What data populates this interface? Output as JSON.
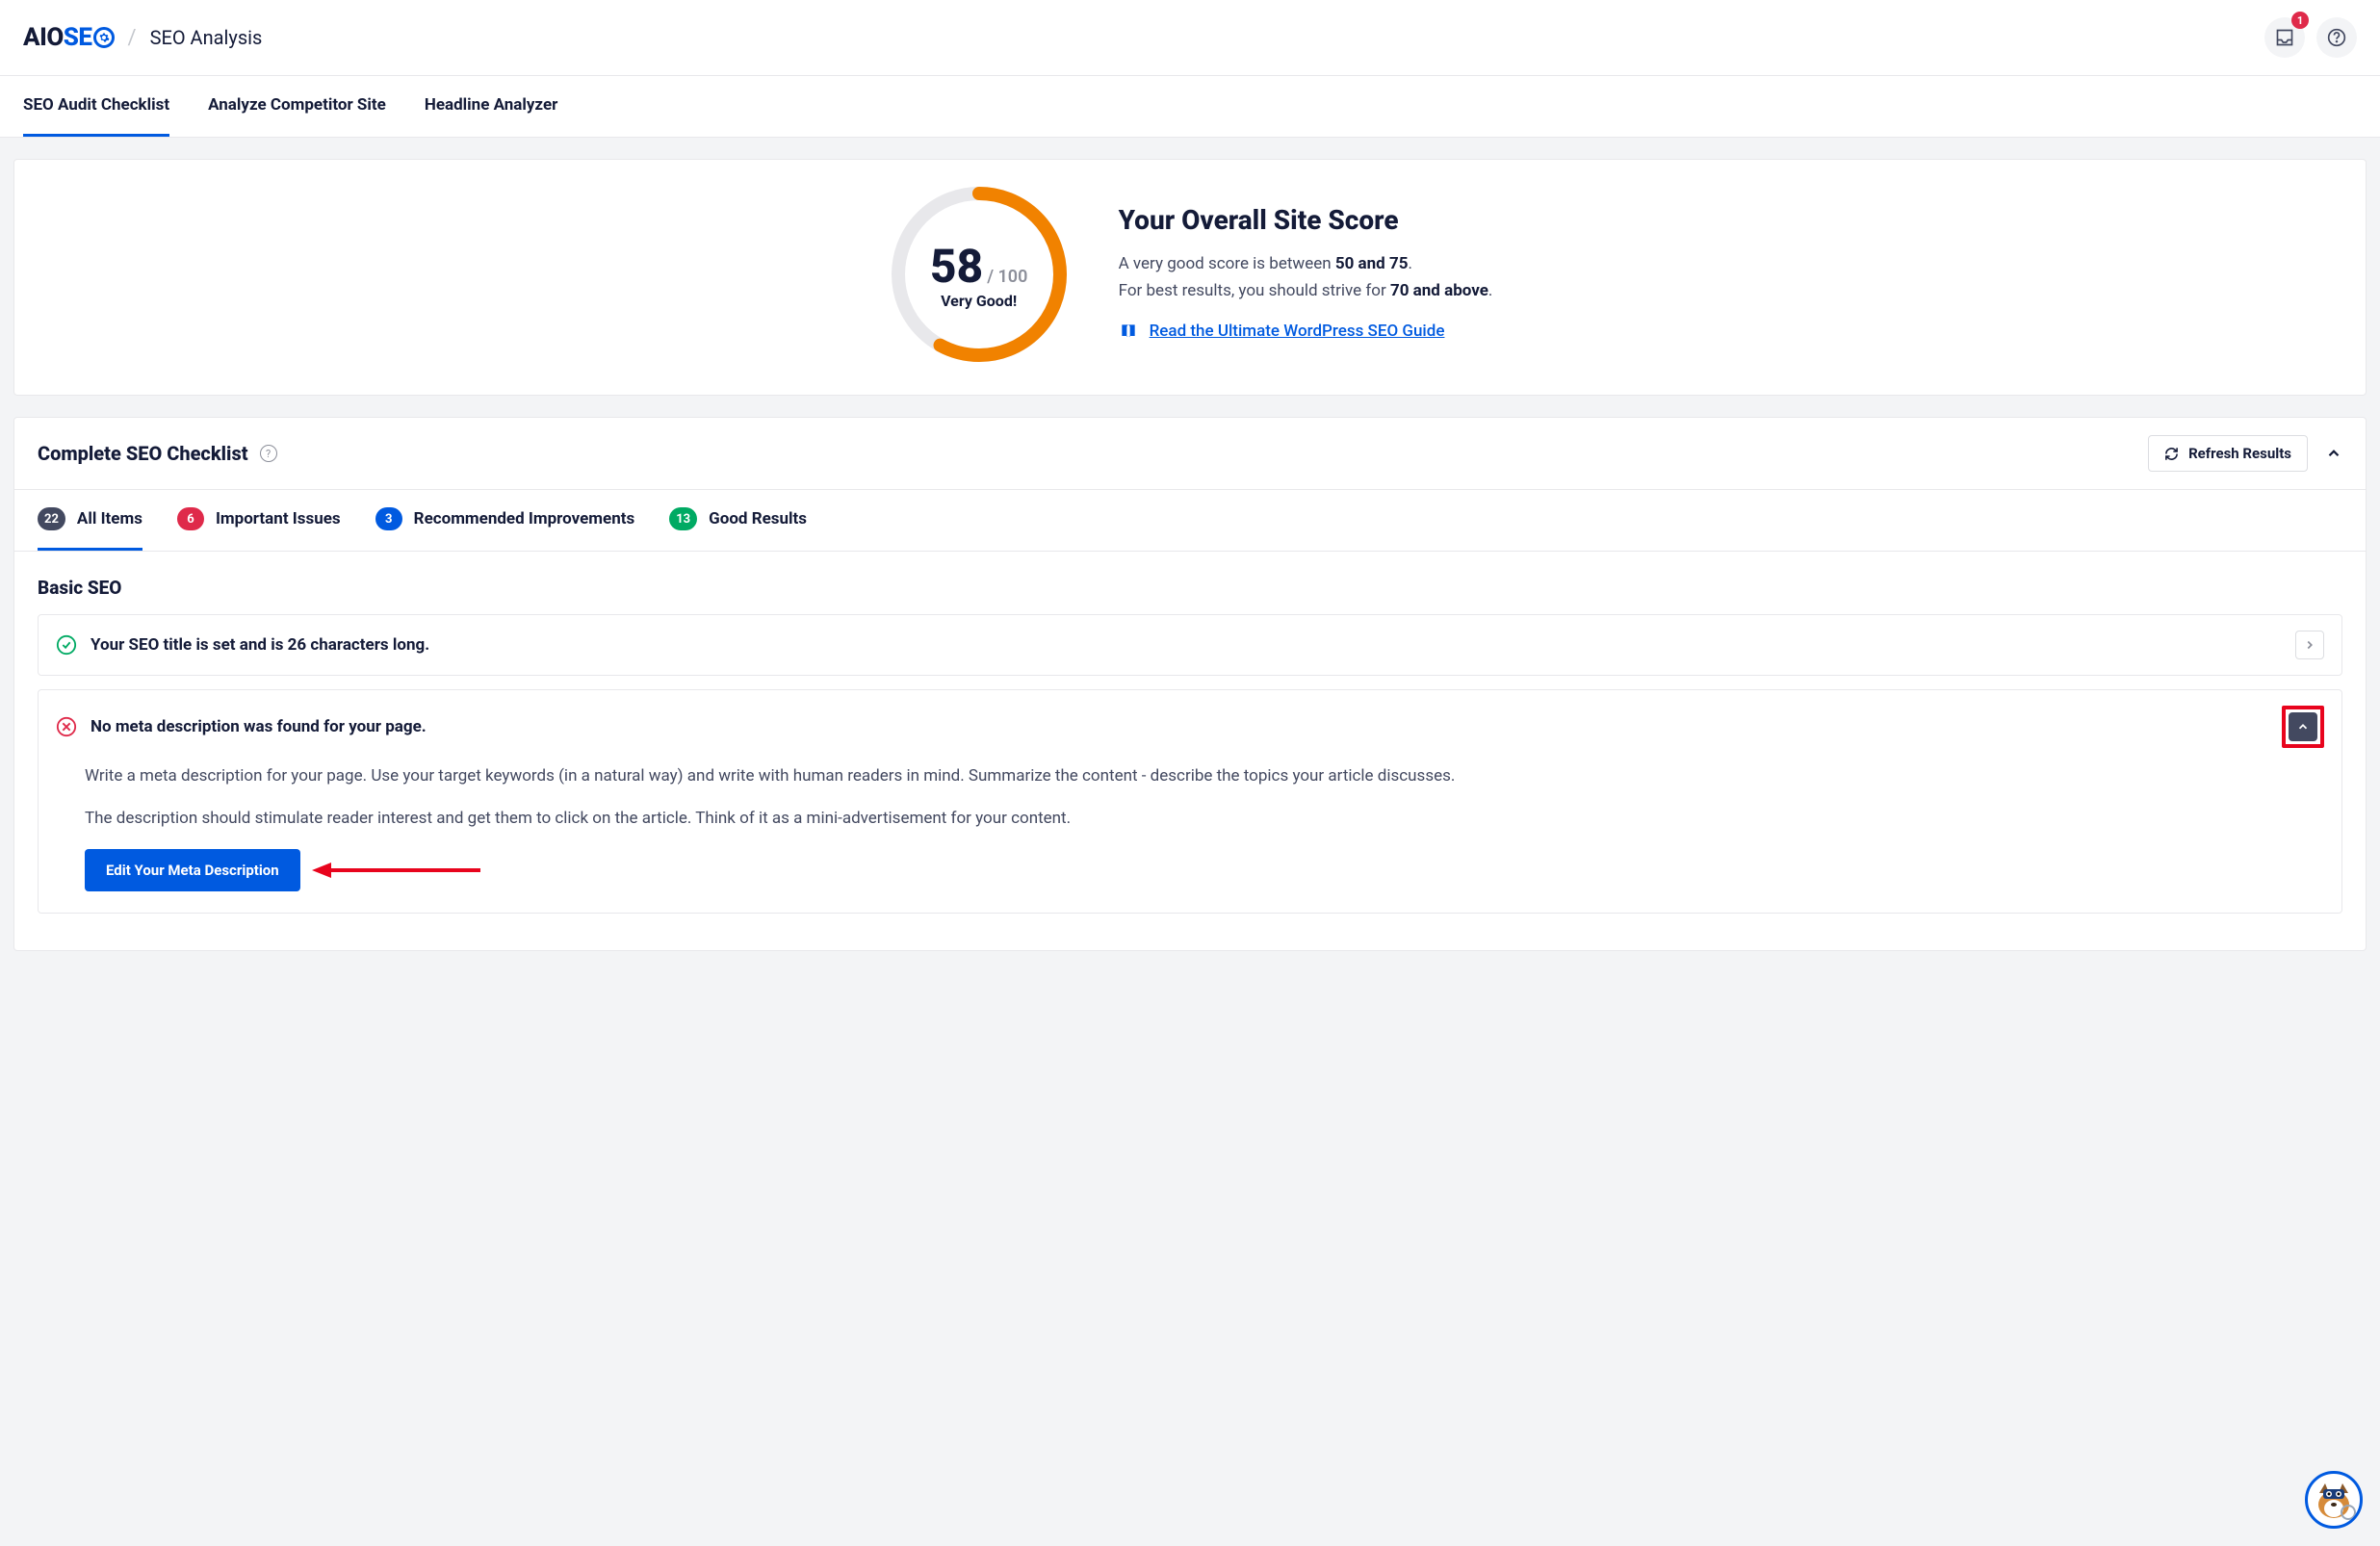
{
  "header": {
    "logo_prefix": "AIO",
    "logo_suffix": "SE",
    "page_title": "SEO Analysis",
    "notification_count": "1"
  },
  "nav_tabs": [
    {
      "label": "SEO Audit Checklist",
      "active": true
    },
    {
      "label": "Analyze Competitor Site",
      "active": false
    },
    {
      "label": "Headline Analyzer",
      "active": false
    }
  ],
  "score": {
    "value": "58",
    "max": "/ 100",
    "label": "Very Good!",
    "heading": "Your Overall Site Score",
    "desc_pre1": "A very good score is between ",
    "desc_bold1": "50 and 75",
    "desc_post1": ".",
    "desc_pre2": "For best results, you should strive for ",
    "desc_bold2": "70 and above",
    "desc_post2": ".",
    "guide_link": "Read the Ultimate WordPress SEO Guide"
  },
  "checklist": {
    "title": "Complete SEO Checklist",
    "refresh": "Refresh Results"
  },
  "filter_tabs": [
    {
      "count": "22",
      "label": "All Items",
      "color": "gray",
      "active": true
    },
    {
      "count": "6",
      "label": "Important Issues",
      "color": "red",
      "active": false
    },
    {
      "count": "3",
      "label": "Recommended Improvements",
      "color": "blue",
      "active": false
    },
    {
      "count": "13",
      "label": "Good Results",
      "color": "green",
      "active": false
    }
  ],
  "section": {
    "title": "Basic SEO",
    "items": [
      {
        "status": "pass",
        "title": "Your SEO title is set and is 26 characters long.",
        "expanded": false
      },
      {
        "status": "fail",
        "title": "No meta description was found for your page.",
        "expanded": true,
        "body_p1": "Write a meta description for your page. Use your target keywords (in a natural way) and write with human readers in mind. Summarize the content - describe the topics your article discusses.",
        "body_p2": "The description should stimulate reader interest and get them to click on the article. Think of it as a mini-advertisement for your content.",
        "action": "Edit Your Meta Description"
      }
    ]
  }
}
